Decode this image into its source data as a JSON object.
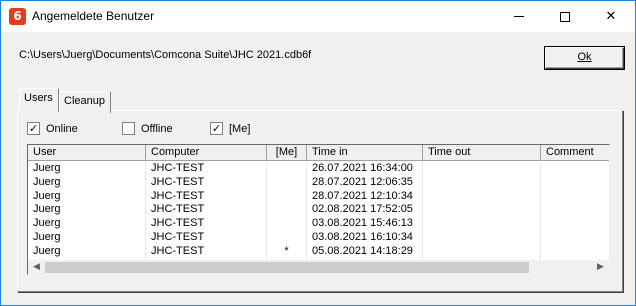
{
  "window": {
    "title": "Angemeldete Benutzer",
    "app_icon_glyph": "6",
    "app_icon_color": "#e23b1f",
    "close_glyph": "✕"
  },
  "path": "C:\\Users\\Juerg\\Documents\\Comcona Suite\\JHC 2021.cdb6f",
  "ok_label": "Ok",
  "tabs": [
    {
      "label": "Users",
      "selected": true
    },
    {
      "label": "Cleanup",
      "selected": false
    }
  ],
  "filters": [
    {
      "label": "Online",
      "checked": true
    },
    {
      "label": "Offline",
      "checked": false
    },
    {
      "label": "[Me]",
      "checked": true
    }
  ],
  "check_glyph": "✓",
  "table": {
    "columns": [
      "User",
      "Computer",
      "[Me]",
      "Time in",
      "Time out",
      "Comment"
    ],
    "rows": [
      [
        "Juerg",
        "JHC-TEST",
        "",
        "26.07.2021 16:34:00",
        "",
        ""
      ],
      [
        "Juerg",
        "JHC-TEST",
        "",
        "28.07.2021 12:06:35",
        "",
        ""
      ],
      [
        "Juerg",
        "JHC-TEST",
        "",
        "28.07.2021 12:10:34",
        "",
        ""
      ],
      [
        "Juerg",
        "JHC-TEST",
        "",
        "02.08.2021 17:52:05",
        "",
        ""
      ],
      [
        "Juerg",
        "JHC-TEST",
        "",
        "03.08.2021 15:46:13",
        "",
        ""
      ],
      [
        "Juerg",
        "JHC-TEST",
        "",
        "03.08.2021 16:10:34",
        "",
        ""
      ],
      [
        "Juerg",
        "JHC-TEST",
        "*",
        "05.08.2021 14:18:29",
        "",
        ""
      ]
    ]
  },
  "scrollbar": {
    "left_glyph": "◀",
    "right_glyph": "▶"
  }
}
